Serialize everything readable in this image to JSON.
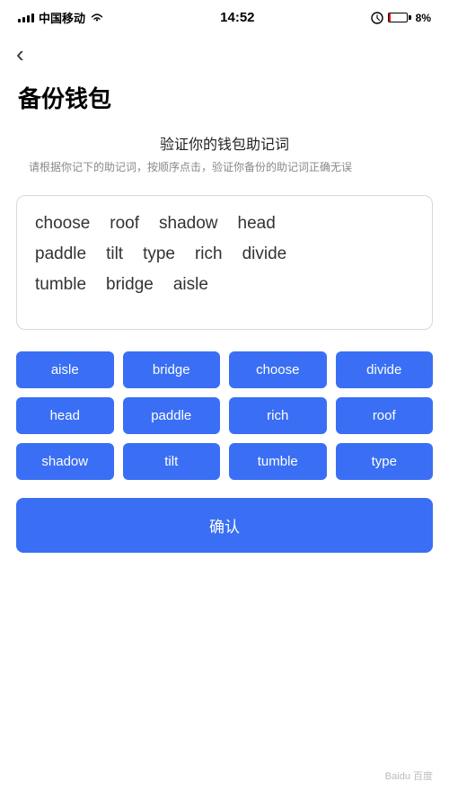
{
  "statusBar": {
    "carrier": "中国移动",
    "time": "14:52",
    "battery": "8%"
  },
  "back": {
    "icon": "‹"
  },
  "page": {
    "title": "备份钱包",
    "subtitle": "验证你的钱包助记词",
    "description": "请根据你记下的助记词，按顺序点击，验证你备份的助记词正确无误"
  },
  "displayWords": [
    [
      "choose",
      "roof",
      "shadow",
      "head"
    ],
    [
      "paddle",
      "tilt",
      "type",
      "rich",
      "divide"
    ],
    [
      "tumble",
      "bridge",
      "aisle"
    ]
  ],
  "wordButtons": [
    "aisle",
    "bridge",
    "choose",
    "divide",
    "head",
    "paddle",
    "rich",
    "roof",
    "shadow",
    "tilt",
    "tumble",
    "type"
  ],
  "confirmButton": "确认",
  "watermark": "Baidu 百度"
}
